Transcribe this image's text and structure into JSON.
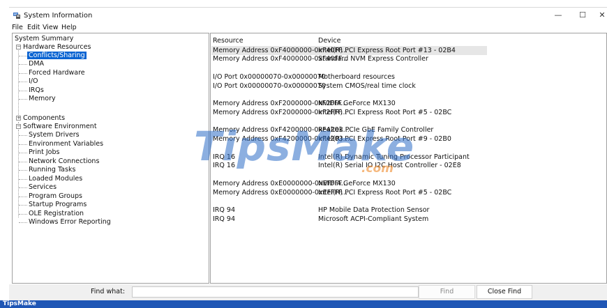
{
  "window": {
    "title": "System Information",
    "controls": {
      "minimize": "—",
      "maximize": "☐",
      "close": "✕"
    }
  },
  "menu": {
    "file": "File",
    "edit": "Edit",
    "view": "View",
    "help": "Help"
  },
  "tree": {
    "system_summary": "System Summary",
    "hardware_resources": "Hardware Resources",
    "conflicts_sharing": "Conflicts/Sharing",
    "dma": "DMA",
    "forced_hardware": "Forced Hardware",
    "io": "I/O",
    "irqs": "IRQs",
    "memory": "Memory",
    "components": "Components",
    "software_environment": "Software Environment",
    "system_drivers": "System Drivers",
    "environment_variables": "Environment Variables",
    "print_jobs": "Print Jobs",
    "network_connections": "Network Connections",
    "running_tasks": "Running Tasks",
    "loaded_modules": "Loaded Modules",
    "services": "Services",
    "program_groups": "Program Groups",
    "startup_programs": "Startup Programs",
    "ole_registration": "OLE Registration",
    "windows_error_reporting": "Windows Error Reporting"
  },
  "table": {
    "headers": {
      "resource": "Resource",
      "device": "Device"
    },
    "rows": [
      {
        "resource": "Memory Address 0xF4000000-0xF40FF...",
        "device": "Intel(R) PCI Express Root Port #13 - 02B4"
      },
      {
        "resource": "Memory Address 0xF4000000-0xF40FF...",
        "device": "Standard NVM Express Controller"
      },
      {
        "resource": "I/O Port 0x00000070-0x00000070",
        "device": "Motherboard resources"
      },
      {
        "resource": "I/O Port 0x00000070-0x00000070",
        "device": "System CMOS/real time clock"
      },
      {
        "resource": "Memory Address 0xF2000000-0xF2FFF...",
        "device": "NVIDIA GeForce MX130"
      },
      {
        "resource": "Memory Address 0xF2000000-0xF2FFF...",
        "device": "Intel(R) PCI Express Root Port #5 - 02BC"
      },
      {
        "resource": "Memory Address 0xF4200000-0xF4203...",
        "device": "Realtek PCIe GbE Family Controller"
      },
      {
        "resource": "Memory Address 0xF4200000-0xF4203...",
        "device": "Intel(R) PCI Express Root Port #9 - 02B0"
      },
      {
        "resource": "IRQ 16",
        "device": "Intel(R) Dynamic Tuning Processor Participant"
      },
      {
        "resource": "IRQ 16",
        "device": "Intel(R) Serial IO I2C Host Controller - 02E8"
      },
      {
        "resource": "Memory Address 0xE0000000-0xEFFFF...",
        "device": "NVIDIA GeForce MX130"
      },
      {
        "resource": "Memory Address 0xE0000000-0xEFFFF...",
        "device": "Intel(R) PCI Express Root Port #5 - 02BC"
      },
      {
        "resource": "IRQ 94",
        "device": "HP Mobile Data Protection Sensor"
      },
      {
        "resource": "IRQ 94",
        "device": "Microsoft ACPI-Compliant System"
      }
    ]
  },
  "find": {
    "label": "Find what:",
    "value": "",
    "find_button": "Find",
    "close_find_button": "Close Find"
  },
  "watermark": {
    "main": "TipsMake",
    "suffix": ".com"
  },
  "footer": {
    "brand": "TipsMake"
  },
  "colors": {
    "selection": "#0a64d2",
    "footer_bar": "#1f56b5",
    "row_highlight": "#e6e6e6",
    "watermark_blue": "#2f6ec7",
    "watermark_orange": "#f08a2a"
  }
}
